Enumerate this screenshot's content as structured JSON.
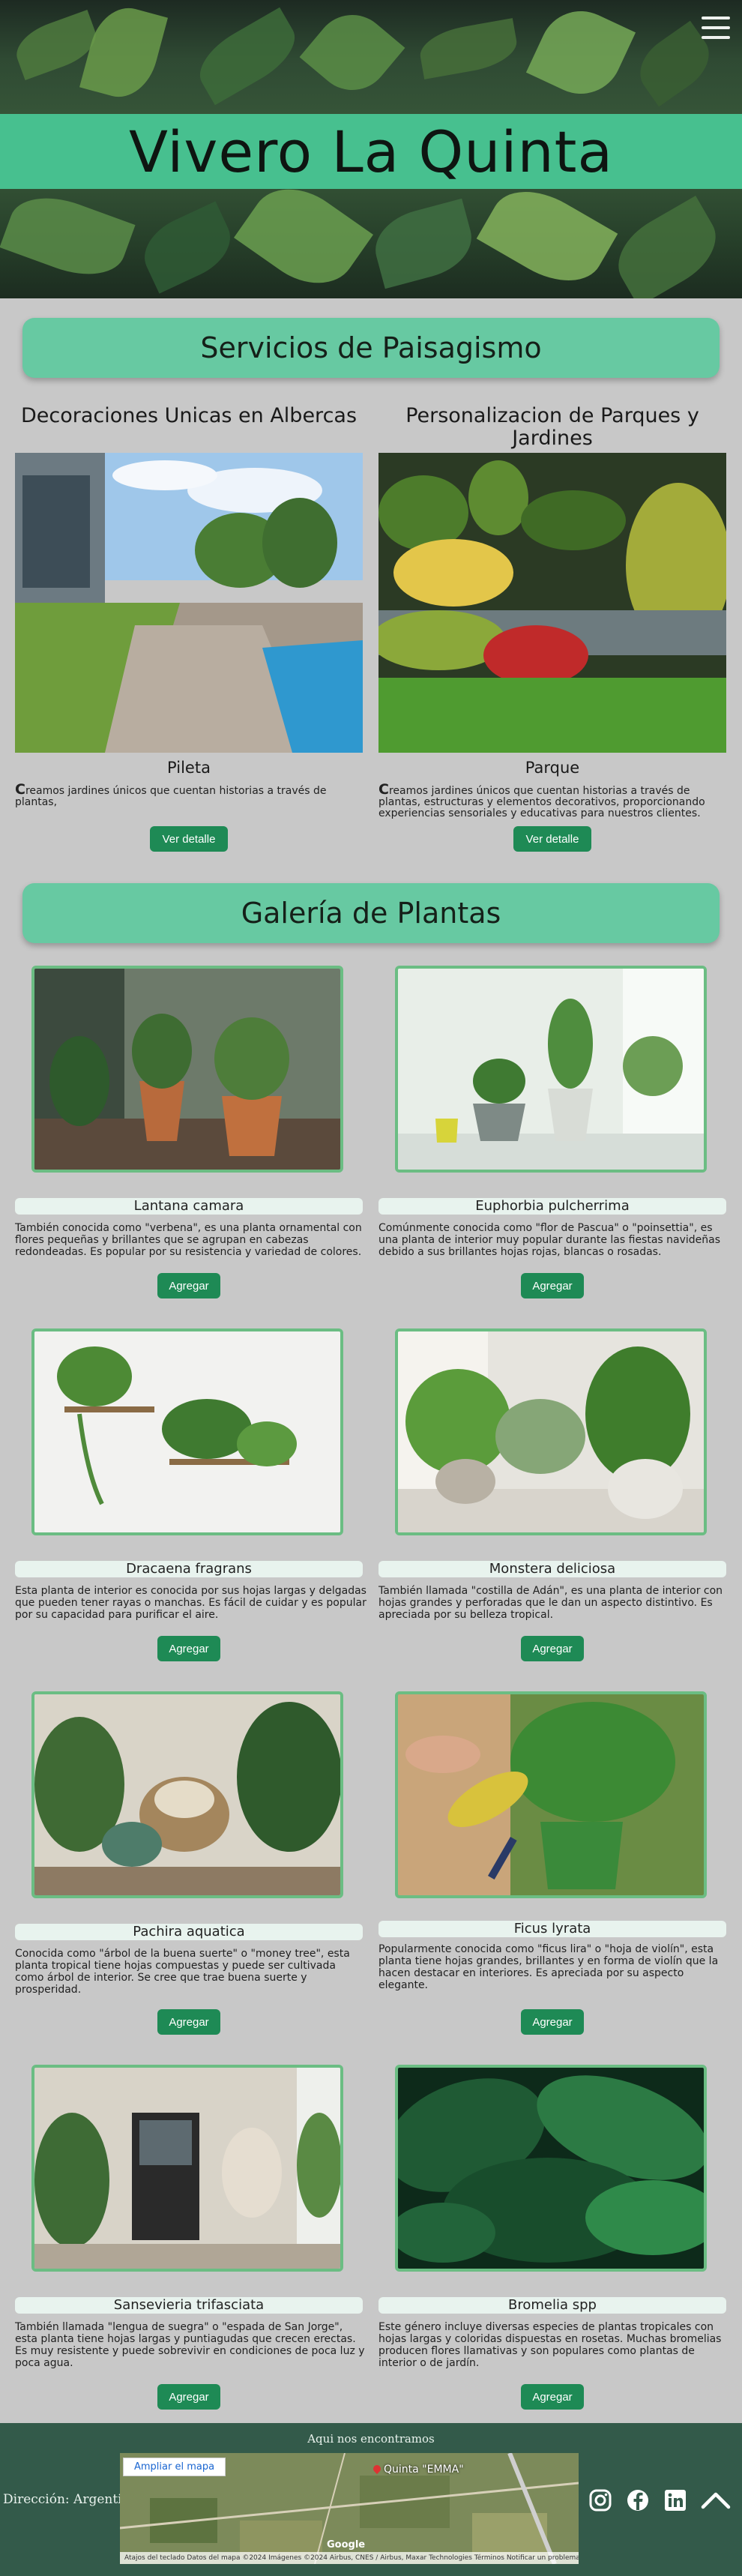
{
  "hero": {
    "title": "Vivero La Quinta",
    "menu_icon": "hamburger-menu-icon"
  },
  "services": {
    "heading": "Servicios de Paisagismo",
    "items": [
      {
        "title": "Decoraciones Unicas en Albercas",
        "label": "Pileta",
        "desc_first": "C",
        "desc_rest": "reamos jardines únicos que cuentan historias a través de plantas,",
        "button": "Ver detalle"
      },
      {
        "title": "Personalizacion de Parques y Jardines",
        "label": "Parque",
        "desc_first": "C",
        "desc_rest": "reamos jardines únicos que cuentan historias a través de plantas, estructuras y elementos decorativos, proporcionando experiencias sensoriales y educativas para nuestros clientes.",
        "button": "Ver detalle"
      }
    ]
  },
  "gallery": {
    "heading": "Galería de Plantas",
    "button_label": "Agregar",
    "plants": [
      {
        "name": "Lantana camara",
        "desc": "También conocida como \"verbena\", es una planta ornamental con flores pequeñas y brillantes que se agrupan en cabezas redondeadas. Es popular por su resistencia y variedad de colores."
      },
      {
        "name": "Euphorbia pulcherrima",
        "desc": "Comúnmente conocida como \"flor de Pascua\" o \"poinsettia\", es una planta de interior muy popular durante las fiestas navideñas debido a sus brillantes hojas rojas, blancas o rosadas."
      },
      {
        "name": "Dracaena fragrans",
        "desc": "Esta planta de interior es conocida por sus hojas largas y delgadas que pueden tener rayas o manchas. Es fácil de cuidar y es popular por su capacidad para purificar el aire."
      },
      {
        "name": "Monstera deliciosa",
        "desc": "También llamada \"costilla de Adán\", es una planta de interior con hojas grandes y perforadas que le dan un aspecto distintivo. Es apreciada por su belleza tropical."
      },
      {
        "name": "Pachira aquatica",
        "desc": "Conocida como \"árbol de la buena suerte\" o \"money tree\", esta planta tropical tiene hojas compuestas y puede ser cultivada como árbol de interior. Se cree que trae buena suerte y prosperidad."
      },
      {
        "name": "Ficus lyrata",
        "desc": "Popularmente conocida como \"ficus lira\" o \"hoja de violín\", esta planta tiene hojas grandes, brillantes y en forma de violín que la hacen destacar en interiores. Es apreciada por su aspecto elegante."
      },
      {
        "name": "Sansevieria trifasciata",
        "desc": "También llamada \"lengua de suegra\" o \"espada de San Jorge\", esta planta tiene hojas largas y puntiagudas que crecen erectas. Es muy resistente y puede sobrevivir en condiciones de poca luz y poca agua."
      },
      {
        "name": "Bromelia spp",
        "desc": "Este género incluye diversas especies de plantas tropicales con hojas largas y coloridas dispuestas en rosetas. Muchas bromelias producen flores llamativas y son populares como plantas de interior o de jardín."
      }
    ]
  },
  "footer": {
    "title": "Aqui nos encontramos",
    "address": "Dirección: Argentina",
    "map_link": "Ampliar el mapa",
    "map_place": "Quinta \"EMMA\"",
    "map_brand": "Google",
    "map_attribution": "Atajos del teclado   Datos del mapa ©2024 Imágenes ©2024 Airbus, CNES / Airbus, Maxar Technologies   Términos   Notificar un problema de Maps",
    "social_icons": [
      "instagram-icon",
      "facebook-icon",
      "linkedin-icon",
      "chevron-up-icon"
    ]
  },
  "colors": {
    "accent": "#47c08f",
    "banner": "#67c9a2",
    "button": "#1e8a55",
    "footer": "#335a4a",
    "background": "#c8c8c8"
  }
}
